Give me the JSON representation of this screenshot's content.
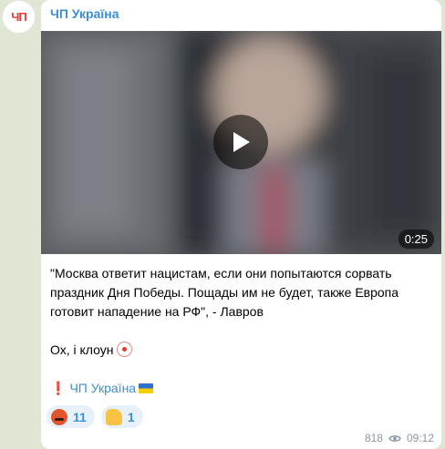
{
  "channel": {
    "name": "ЧП Україна",
    "avatar_text": "ЧП"
  },
  "video": {
    "duration": "0:25"
  },
  "message": {
    "quote": "\"Москва ответит нацистам, если они попытаются сорвать праздник Дня Победы. Пощады им не будет, также Европа готовит нападение на РФ\", - Лавров",
    "comment": "Ох, і клоун",
    "signature_mark": "❗",
    "signature": "ЧП Україна"
  },
  "reactions": [
    {
      "icon": "angry-face-icon",
      "count": "11"
    },
    {
      "icon": "thumbs-up-icon",
      "count": "1"
    }
  ],
  "meta": {
    "views": "818",
    "time": "09:12"
  },
  "colors": {
    "link": "#3a8fd6",
    "background": "#dfe7d4",
    "bubble": "#ffffff"
  }
}
